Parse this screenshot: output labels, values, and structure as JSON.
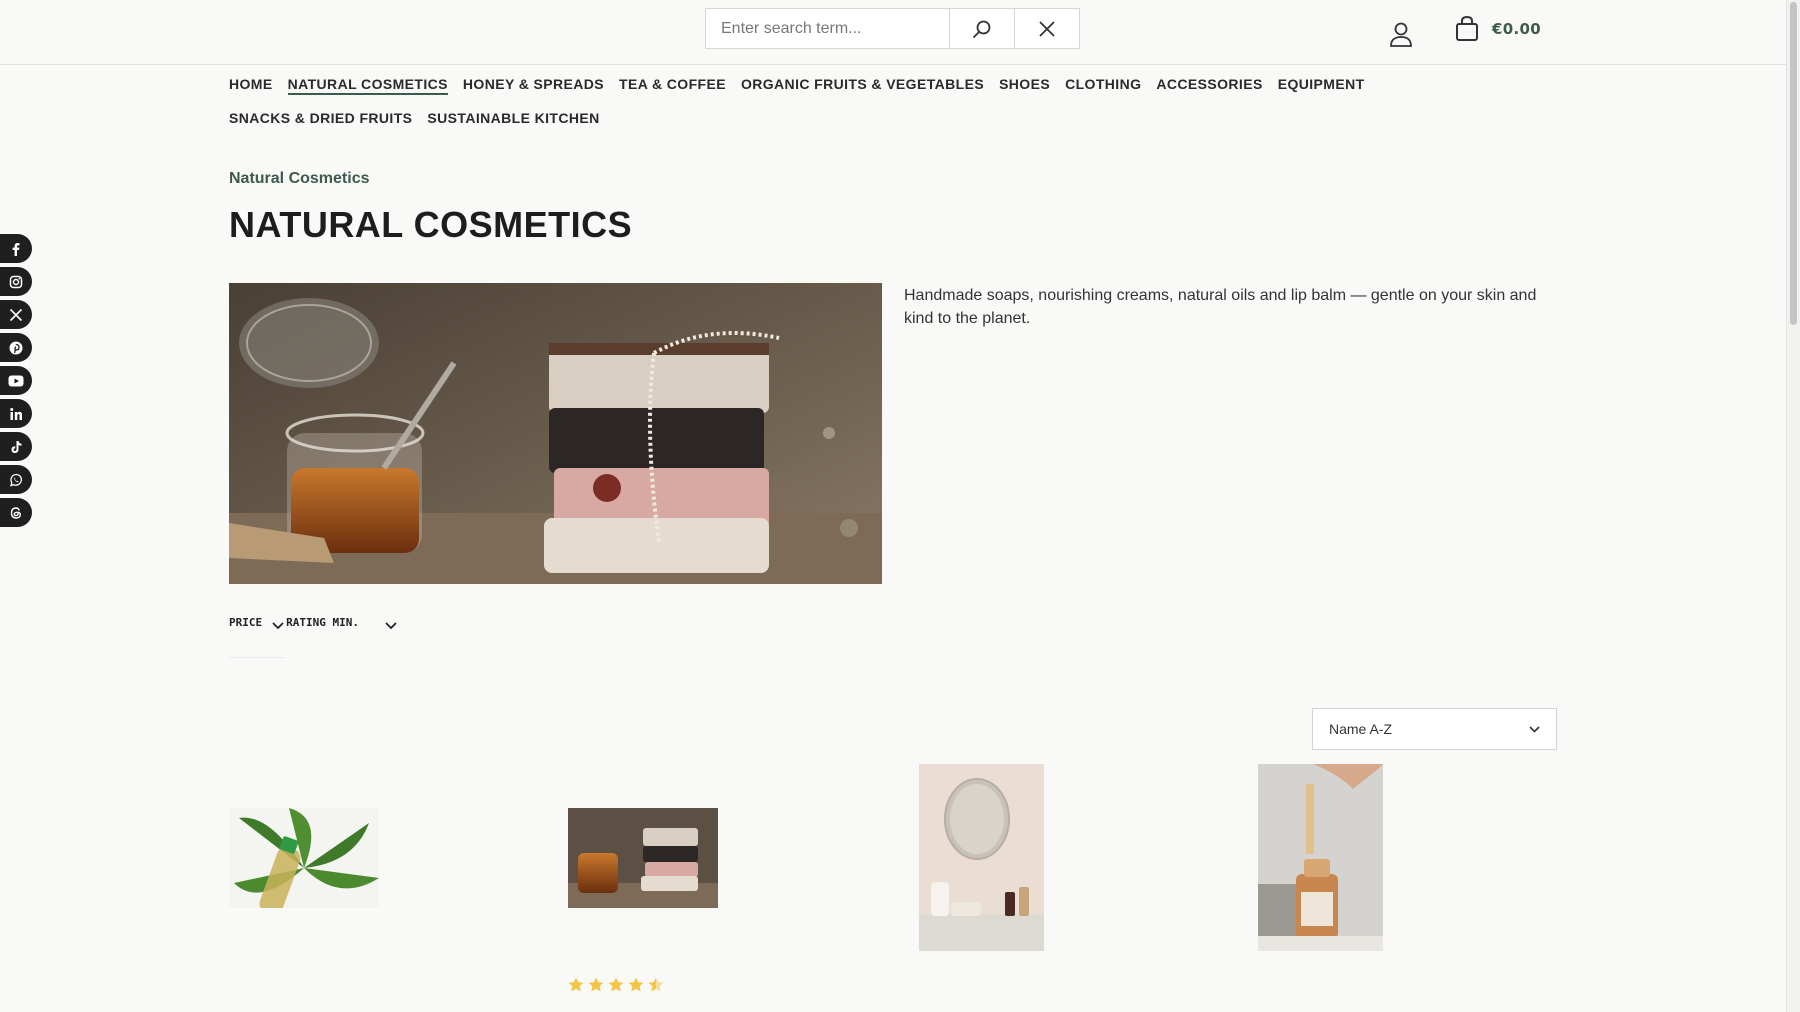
{
  "header": {
    "search_placeholder": "Enter search term...",
    "cart_total": "€0.00"
  },
  "nav": {
    "items": [
      {
        "label": "HOME"
      },
      {
        "label": "NATURAL COSMETICS",
        "active": true
      },
      {
        "label": "HONEY & SPREADS"
      },
      {
        "label": "TEA & COFFEE"
      },
      {
        "label": "ORGANIC FRUITS & VEGETABLES"
      },
      {
        "label": "SHOES"
      },
      {
        "label": "CLOTHING"
      },
      {
        "label": "ACCESSORIES"
      },
      {
        "label": "EQUIPMENT"
      },
      {
        "label": "SNACKS & DRIED FRUITS"
      },
      {
        "label": "SUSTAINABLE KITCHEN"
      }
    ]
  },
  "social": [
    "facebook-icon",
    "instagram-icon",
    "x-icon",
    "pinterest-icon",
    "youtube-icon",
    "linkedin-icon",
    "tiktok-icon",
    "whatsapp-icon",
    "threads-icon"
  ],
  "page": {
    "breadcrumb": "Natural Cosmetics",
    "title": "NATURAL COSMETICS",
    "description": "Handmade soaps, nourishing creams, natural oils and lip balm — gentle on your skin and kind to the planet."
  },
  "filters": {
    "price_label": "PRICE",
    "rating_label": "RATING MIN."
  },
  "sort": {
    "selected": "Name A-Z"
  },
  "products": [
    {
      "image": "leaf-bottle-image"
    },
    {
      "image": "soap-stack-image",
      "rating": 4.5
    },
    {
      "image": "mirror-bathroom-image"
    },
    {
      "image": "serum-dropper-image"
    }
  ],
  "colors": {
    "accent": "#3d5a4e",
    "star": "#f4c542"
  }
}
